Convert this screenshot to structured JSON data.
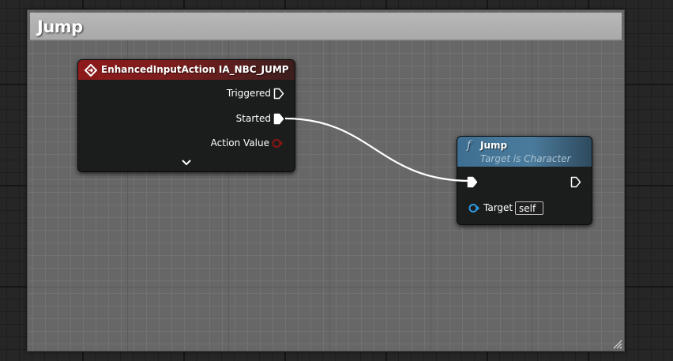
{
  "comment": {
    "title": "Jump"
  },
  "event_node": {
    "title": "EnhancedInputAction IA_NBC_JUMP",
    "header_color": "#8e1a1a",
    "pins": {
      "triggered": "Triggered",
      "started": "Started",
      "action_value": "Action Value"
    },
    "action_value_pin_color": "#8b1414",
    "expand_icon": "chevron-down-icon"
  },
  "function_node": {
    "icon": "f",
    "title": "Jump",
    "subtitle": "Target is Character",
    "header_color": "#3e6f91",
    "target_label": "Target",
    "target_value": "self",
    "target_pin_color": "#2d9ae0"
  },
  "wire": {
    "from": "Started",
    "to": "Jump",
    "color": "#ffffff"
  }
}
